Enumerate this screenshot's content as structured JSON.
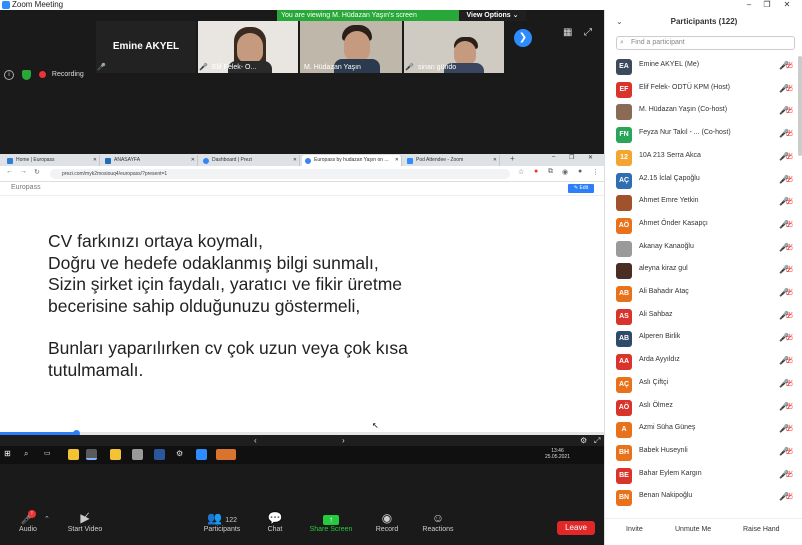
{
  "window": {
    "title": "Zoom Meeting"
  },
  "banner": {
    "message": "You are viewing M. Hüdazan Yaşın's screen",
    "view_options": "View Options"
  },
  "tiles": [
    {
      "name": "Emine AKYEL"
    },
    {
      "name": "Elif Felek- O..."
    },
    {
      "name": "M. Hüdazan Yaşın"
    },
    {
      "name": "sinan gündo"
    }
  ],
  "status": {
    "recording": "Recording"
  },
  "browser": {
    "tabs": [
      "Home | Europass",
      "ANASAYFA",
      "Dashboard | Prezi",
      "Europass by hudazan Yaşın on ...",
      "Pod Attendee - Zoom"
    ],
    "url": "prezi.com/myk2mosiouq4/europass/?present=1",
    "brand": "Europass",
    "edit_label": "Edit",
    "clock_time": "13:46",
    "clock_date": "25.05.2021"
  },
  "slide": {
    "paragraphs": [
      [
        "CV farkınızı ortaya koymalı,",
        "Doğru ve hedefe odaklanmış bilgi sunmalı,",
        "Sizin şirket için faydalı, yaratıcı ve fikir üretme",
        "becerisine sahip olduğunuzu göstermeli,"
      ],
      [
        "Bunları yaparılırken  cv çok uzun veya çok kısa",
        "tutulmamalı."
      ]
    ],
    "progress": 0.125
  },
  "toolbar": {
    "audio": "Audio",
    "start_video": "Start Video",
    "participants": "Participants",
    "participants_count": "122",
    "chat": "Chat",
    "share_screen": "Share Screen",
    "record": "Record",
    "reactions": "Reactions",
    "leave": "Leave"
  },
  "panel": {
    "title": "Participants (122)",
    "search_placeholder": "Find a participant",
    "invite": "Invite",
    "unmute_me": "Unmute Me",
    "raise_hand": "Raise Hand",
    "participants": [
      {
        "initials": "EA",
        "color": "#3b4a5c",
        "name": "Emine AKYEL (Me)"
      },
      {
        "initials": "EF",
        "color": "#d9342b",
        "name": "Elif Felek- ODTÜ KPM (Host)"
      },
      {
        "initials": "",
        "color": "#8a6b55",
        "name": "M. Hüdazan Yaşın (Co-host)"
      },
      {
        "initials": "FN",
        "color": "#27a65a",
        "name": "Feyza Nur Takıl - ...  (Co-host)"
      },
      {
        "initials": "12",
        "color": "#f2a531",
        "name": "10A 213 Serra Akca"
      },
      {
        "initials": "AÇ",
        "color": "#2f6fb1",
        "name": "A2.15 İclal Çapoğlu"
      },
      {
        "initials": "",
        "color": "#a0522d",
        "name": "Ahmet Emre Yetkin"
      },
      {
        "initials": "AÖ",
        "color": "#e8721c",
        "name": "Ahmet Önder Kasapçı"
      },
      {
        "initials": "",
        "color": "#9a9a9a",
        "name": "Akanay Kanaoğlu"
      },
      {
        "initials": "",
        "color": "#4a2e24",
        "name": "aleyna kiraz gul"
      },
      {
        "initials": "AB",
        "color": "#e8721c",
        "name": "Ali Bahadır Ataç"
      },
      {
        "initials": "AS",
        "color": "#d9342b",
        "name": "Ali Sahbaz"
      },
      {
        "initials": "AB",
        "color": "#2f4a6b",
        "name": "Alperen Birlik"
      },
      {
        "initials": "AA",
        "color": "#d9342b",
        "name": "Arda Ayyıldız"
      },
      {
        "initials": "AÇ",
        "color": "#e8721c",
        "name": "Aslı Çiftçi"
      },
      {
        "initials": "AÖ",
        "color": "#d9342b",
        "name": "Aslı Ölmez"
      },
      {
        "initials": "A",
        "color": "#e8721c",
        "name": "Azmi Süha Güneş"
      },
      {
        "initials": "BH",
        "color": "#e8721c",
        "name": "Babek Huseynli"
      },
      {
        "initials": "BE",
        "color": "#d9342b",
        "name": "Bahar Eylem Kargın"
      },
      {
        "initials": "BN",
        "color": "#e8721c",
        "name": "Benan Nakipoğlu"
      }
    ]
  }
}
